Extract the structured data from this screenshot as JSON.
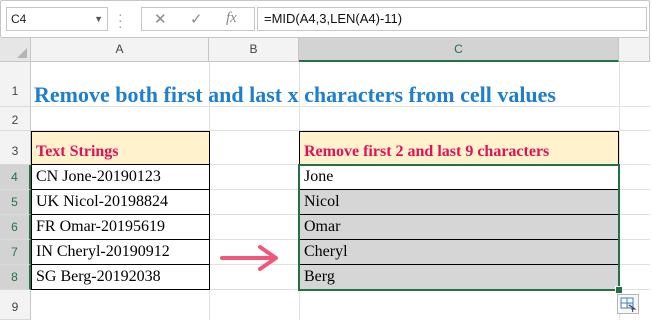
{
  "formula_bar": {
    "name_box": "C4",
    "cancel_icon": "close-icon",
    "enter_icon": "check-icon",
    "fx_label": "fx",
    "formula": "=MID(A4,3,LEN(A4)-11)"
  },
  "columns": [
    "A",
    "B",
    "C"
  ],
  "rows": [
    "1",
    "2",
    "3",
    "4",
    "5",
    "6",
    "7",
    "8",
    "9"
  ],
  "title": "Remove both first and last x characters from cell values",
  "left_table": {
    "header": "Text Strings",
    "cells": [
      "CN Jone-20190123",
      "UK Nicol-20198824",
      "FR Omar-20195619",
      "IN Cheryl-20190912",
      "SG Berg-20192038"
    ]
  },
  "right_table": {
    "header": "Remove first 2 and last 9 characters",
    "cells": [
      "Jone",
      "Nicol",
      "Omar",
      "Cheryl",
      "Berg"
    ]
  },
  "colors": {
    "title": "#1f7fcf",
    "header_text": "#e0105a",
    "header_fill": "#fff2cc",
    "selection": "#217346",
    "arrow": "#f0587a",
    "selected_fill": "#d6d6d6"
  },
  "quick_analysis_icon": "quick-analysis-icon"
}
